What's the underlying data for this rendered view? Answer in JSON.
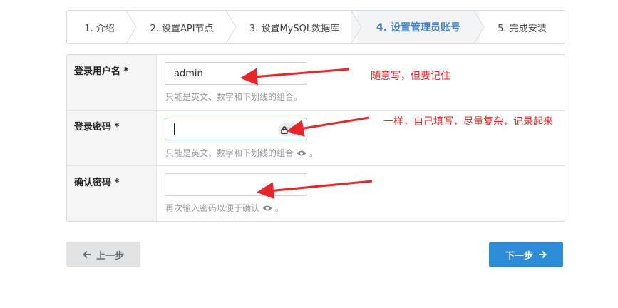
{
  "steps": [
    {
      "label": "1. 介绍"
    },
    {
      "label": "2. 设置API节点"
    },
    {
      "label": "3. 设置MySQL数据库"
    },
    {
      "label": "4. 设置管理员账号"
    },
    {
      "label": "5. 完成安装"
    }
  ],
  "active_step": 4,
  "form": {
    "username": {
      "label": "登录用户名 *",
      "value": "admin",
      "hint": "只能是英文、数字和下划线的组合。"
    },
    "password": {
      "label": "登录密码 *",
      "value": "",
      "hint": "只能是英文、数字和下划线的组合",
      "hint_suffix": "。"
    },
    "confirm": {
      "label": "确认密码 *",
      "value": "",
      "hint": "再次输入密码以便于确认",
      "hint_suffix": "。"
    }
  },
  "annotations": {
    "username_note": "随意写，但要记住",
    "password_note": "一样，自己填写，尽量复杂，记录起来"
  },
  "buttons": {
    "prev": "上一步",
    "next": "下一步"
  },
  "colors": {
    "accent": "#2d8cd8",
    "active_step_text": "#3f7fc3",
    "annotation": "#e8262a"
  },
  "icons": [
    "eye-icon",
    "lock-icon",
    "arrow-left-icon",
    "arrow-right-icon"
  ]
}
